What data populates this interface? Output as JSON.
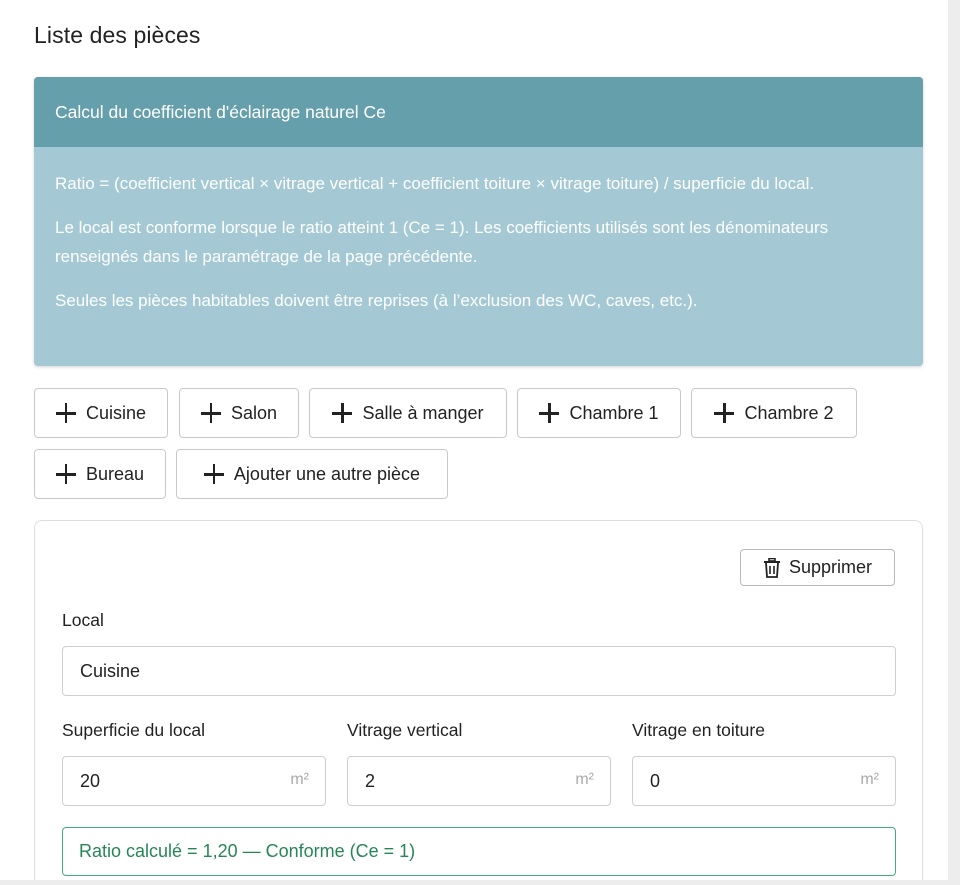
{
  "page": {
    "title": "Liste des pièces"
  },
  "info": {
    "header": "Calcul du coefficient d'éclairage naturel Ce",
    "paragraphs": [
      "Ratio = (coefficient vertical × vitrage vertical + coefficient toiture × vitrage toiture) / superficie du local.",
      "Le local est conforme lorsque le ratio atteint 1 (Ce = 1). Les coefficients utilisés sont les dénominateurs renseignés dans le paramétrage de la page précédente.",
      "Seules les pièces habitables doivent être reprises (à l’exclusion des WC, caves, etc.)."
    ]
  },
  "room_buttons": [
    "Cuisine",
    "Salon",
    "Salle à manger",
    "Chambre 1",
    "Chambre 2",
    "Bureau",
    "Ajouter une autre pièce"
  ],
  "room": {
    "delete_label": "Supprimer",
    "local_label": "Local",
    "local_value": "Cuisine",
    "superficie_label": "Superficie du local",
    "superficie_value": "20",
    "vitrage_vertical_label": "Vitrage vertical",
    "vitrage_vertical_value": "2",
    "vitrage_toiture_label": "Vitrage en toiture",
    "vitrage_toiture_value": "0",
    "unit": "m²",
    "result": "Ratio calculé = 1,20 — Conforme (Ce = 1)"
  },
  "colors": {
    "info_header": "#659fab",
    "info_body": "#a4c9d4",
    "success": "#258755",
    "success_border": "#3fae7d"
  },
  "icons": {
    "add": "plus-icon",
    "delete": "trash-icon"
  }
}
